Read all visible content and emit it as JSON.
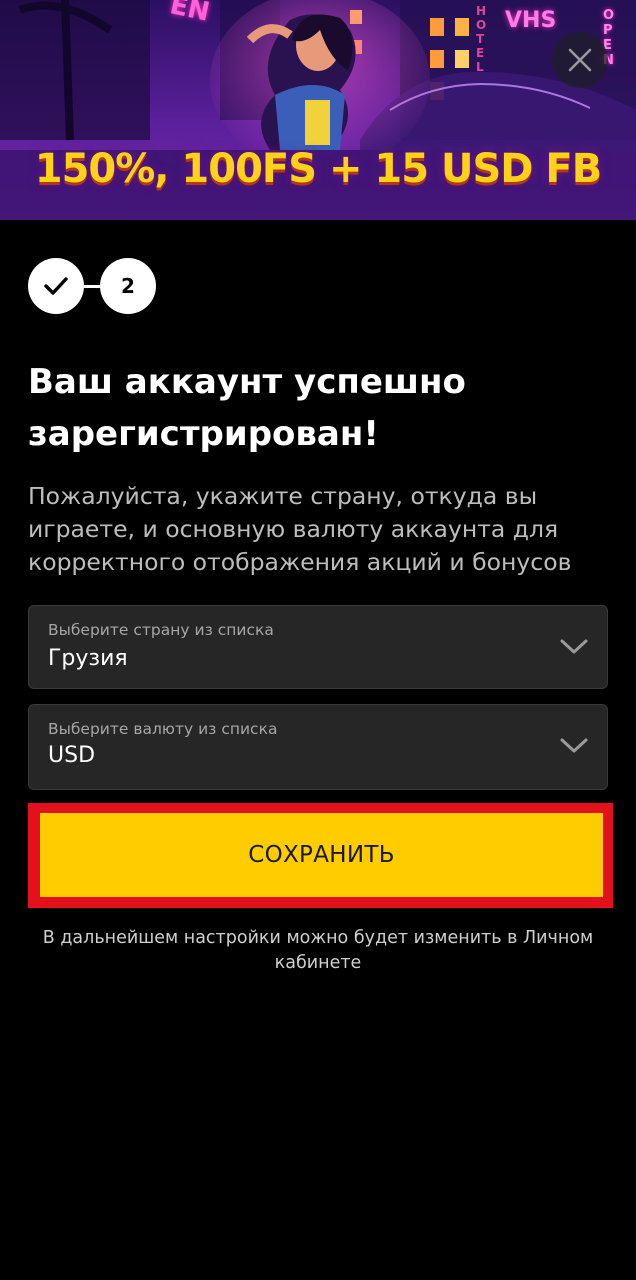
{
  "banner": {
    "promo": "150%, 100FS + 15 USD FB",
    "close_icon": "close-icon",
    "signs": {
      "vhs": "VHS",
      "open": "OPEN",
      "hotel": "HOTEL",
      "en": "EN"
    }
  },
  "stepper": {
    "step1_icon": "check-icon",
    "step2_label": "2"
  },
  "heading": {
    "title": "Ваш аккаунт успешно зарегистрирован!",
    "subtitle": "Пожалуйста, укажите страну, откуда вы играете, и основную валюту аккаунта для корректного отображения акций и бонусов"
  },
  "country_select": {
    "label": "Выберите страну из списка",
    "value": "Грузия",
    "icon": "chevron-down-icon"
  },
  "currency_select": {
    "label": "Выберите валюту из списка",
    "value": "USD",
    "icon": "chevron-down-icon"
  },
  "save_button": {
    "label": "СОХРАНИТЬ"
  },
  "note": "В дальнейшем настройки можно будет изменить в Личном кабинете",
  "colors": {
    "background": "#000000",
    "accent": "#ffcc00",
    "highlight": "#e3111b",
    "promo_text": "#ffd21a"
  }
}
